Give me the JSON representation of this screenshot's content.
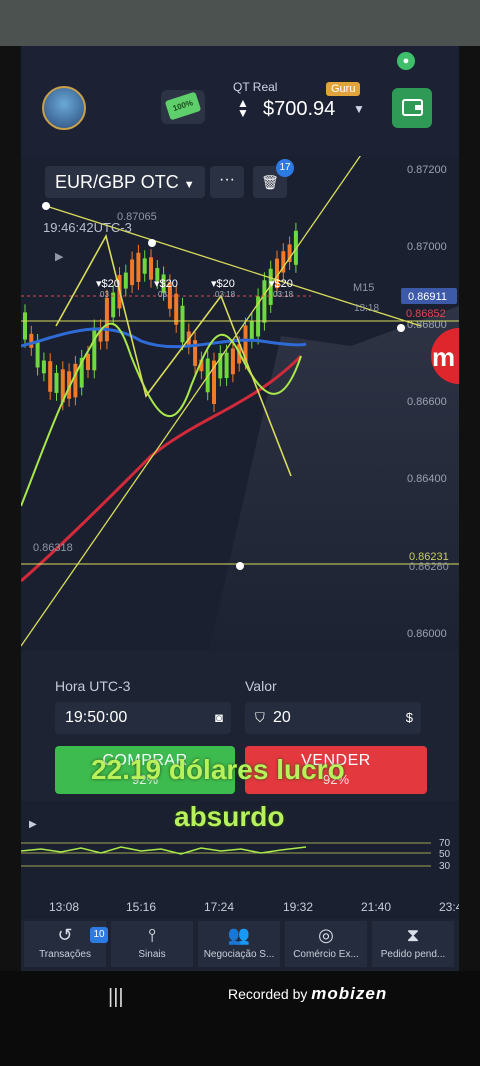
{
  "account": {
    "type": "QT Real",
    "badge": "Guru",
    "balance": "$700.94",
    "promo": "100%"
  },
  "asset": {
    "pair": "EUR/GBP OTC",
    "notifications": "17"
  },
  "chart": {
    "time_label": "19:46:42UTC-3",
    "high_label": "0.87065",
    "low_label": "0.86318",
    "timeframe": "M15",
    "timer": "13:18",
    "price_badge": "0.86911",
    "price_red": "0.86852",
    "price_right_low": "0.86231",
    "price_right_low2": "0.86280",
    "y_ticks": [
      "0.87200",
      "0.87000",
      "0.86800",
      "0.86600",
      "0.86400",
      "0.86000"
    ],
    "trade_markers": [
      {
        "amount": "$20",
        "time": "03"
      },
      {
        "amount": "$20",
        "time": "03"
      },
      {
        "amount": "$20",
        "time": "03:18"
      },
      {
        "amount": "$20",
        "time": "03:18"
      }
    ]
  },
  "trade_panel": {
    "time_label": "Hora UTC-3",
    "time_value": "19:50:00",
    "amount_label": "Valor",
    "amount_value": "20",
    "buy_label": "COMPRAR",
    "buy_pct": "92%",
    "sell_label": "VENDER",
    "sell_pct": "92%"
  },
  "overlay_text": {
    "line1": "22.19 dólares lucro",
    "line2": "absurdo"
  },
  "oscillator": {
    "levels": [
      "70",
      "50",
      "30"
    ]
  },
  "time_axis": [
    "13:08",
    "15:16",
    "17:24",
    "19:32",
    "21:40",
    "23:4"
  ],
  "nav": [
    {
      "label": "Transações",
      "icon": "history-icon",
      "badge": "10"
    },
    {
      "label": "Sinais",
      "icon": "signal-icon"
    },
    {
      "label": "Negociação S...",
      "icon": "social-icon"
    },
    {
      "label": "Comércio Ex...",
      "icon": "target-icon"
    },
    {
      "label": "Pedido pend...",
      "icon": "hourglass-icon"
    }
  ],
  "recorder": {
    "text": "Recorded by",
    "brand": "mobizen"
  },
  "colors": {
    "buy": "#3dbb4f",
    "sell": "#e4383f",
    "overlay": "#b8f25a",
    "wallet": "#2f9a55"
  }
}
